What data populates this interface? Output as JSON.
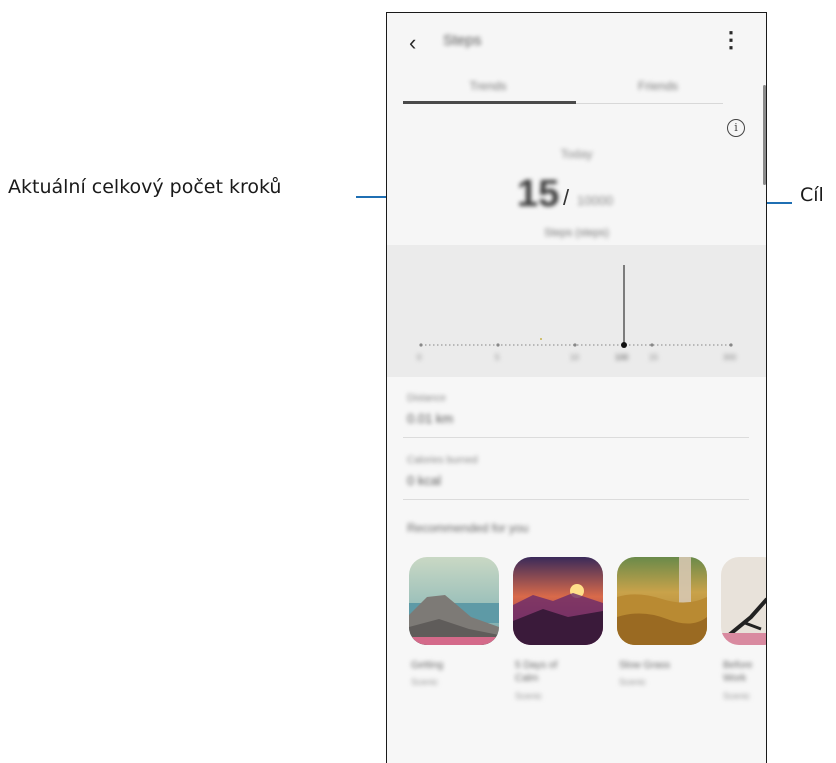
{
  "callouts": {
    "current_steps_label": "Aktuální celkový počet kroků",
    "goal_label": "Cíl",
    "line_color": "#1f6fb3"
  },
  "app": {
    "back_icon": "chevron-left-icon",
    "title": "Steps",
    "more_icon": "more-vert-icon",
    "tabs": [
      {
        "label": "Trends"
      },
      {
        "label": "Friends"
      }
    ],
    "info_icon": "info-icon",
    "period": "Today",
    "steps": {
      "current": "15",
      "slash": "/",
      "goal": "10000",
      "unit": "Steps (steps)"
    },
    "chart_ticks": [
      "0",
      "5",
      "10",
      "100",
      "15",
      "300"
    ],
    "stats": [
      {
        "label": "Distance",
        "value": "0.01 km"
      },
      {
        "label": "Calories burned",
        "value": "0 kcal"
      }
    ],
    "recommended": {
      "title": "Recommended for you",
      "items": [
        {
          "title": "Getting",
          "subtitle": "Scenic"
        },
        {
          "title": "5 Days of Calm",
          "subtitle": "Scenic"
        },
        {
          "title": "Slow Grass",
          "subtitle": "Scenic"
        },
        {
          "title": "Before Work",
          "subtitle": "Scenic"
        }
      ]
    }
  }
}
